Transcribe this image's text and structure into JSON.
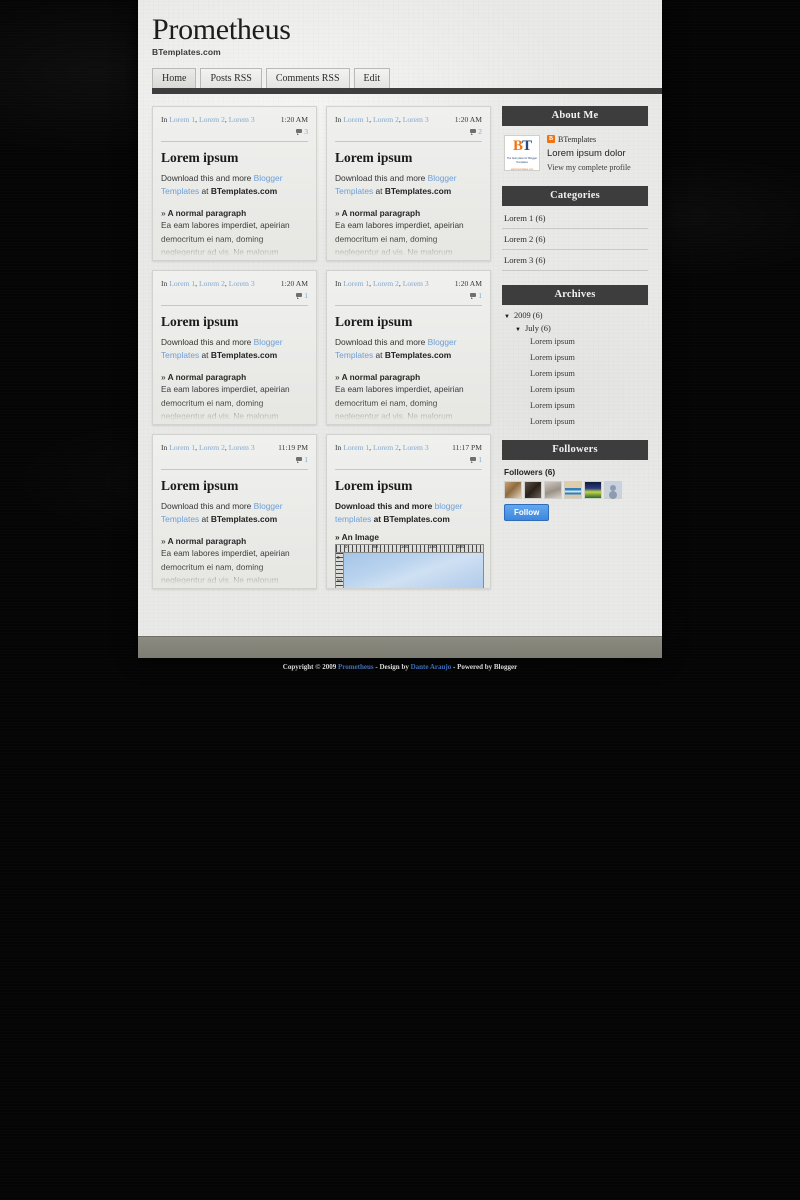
{
  "header": {
    "title": "Prometheus",
    "description": "BTemplates.com",
    "nav": [
      {
        "label": "Home",
        "active": true
      },
      {
        "label": "Posts RSS",
        "active": false
      },
      {
        "label": "Comments RSS",
        "active": false
      },
      {
        "label": "Edit",
        "active": false
      }
    ]
  },
  "posts": [
    {
      "in_label": "In",
      "tags": [
        "Lorem 1",
        "Lorem 2",
        "Lorem 3"
      ],
      "time": "1:20 AM",
      "comments": "3",
      "title": "Lorem ipsum",
      "lead_prefix": "Download this and more ",
      "lead_link": "Blogger Templates",
      "lead_mid": " at ",
      "lead_bold": "BTemplates.com",
      "sub_head": "A normal paragraph",
      "excerpt": "Ea eam labores imperdiet, apeirian democritum ei nam, doming neglegentur ad vis. Ne malorum ceteros feugait quo, ius ea liber efficiendi cum, ne cum dolorem"
    },
    {
      "in_label": "In",
      "tags": [
        "Lorem 1",
        "Lorem 2",
        "Lorem 3"
      ],
      "time": "1:20 AM",
      "comments": "2",
      "title": "Lorem ipsum",
      "lead_prefix": "Download this and more ",
      "lead_link": "Blogger Templates",
      "lead_mid": " at ",
      "lead_bold": "BTemplates.com",
      "sub_head": "A normal paragraph",
      "excerpt": "Ea eam labores imperdiet, apeirian democritum ei nam, doming neglegentur ad vis. Ne malorum ceteros feugait quo, ius ea liber efficiendi cum, ne cum dolorem"
    },
    {
      "in_label": "In",
      "tags": [
        "Lorem 1",
        "Lorem 2",
        "Lorem 3"
      ],
      "time": "1:20 AM",
      "comments": "1",
      "title": "Lorem ipsum",
      "lead_prefix": "Download this and more ",
      "lead_link": "Blogger Templates",
      "lead_mid": " at ",
      "lead_bold": "BTemplates.com",
      "sub_head": "A normal paragraph",
      "excerpt": "Ea eam labores imperdiet, apeirian democritum ei nam, doming neglegentur ad vis. Ne malorum ceteros feugait quo, ius ea liber efficiendi cum, ne cum dolorem"
    },
    {
      "in_label": "In",
      "tags": [
        "Lorem 1",
        "Lorem 2",
        "Lorem 3"
      ],
      "time": "1:20 AM",
      "comments": "1",
      "title": "Lorem ipsum",
      "lead_prefix": "Download this and more ",
      "lead_link": "Blogger Templates",
      "lead_mid": " at ",
      "lead_bold": "BTemplates.com",
      "sub_head": "A normal paragraph",
      "excerpt": "Ea eam labores imperdiet, apeirian democritum ei nam, doming neglegentur ad vis. Ne malorum ceteros feugait quo, ius ea liber efficiendi cum, ne cum dolorem"
    },
    {
      "in_label": "In",
      "tags": [
        "Lorem 1",
        "Lorem 2",
        "Lorem 3"
      ],
      "time": "11:19 PM",
      "comments": "1",
      "title": "Lorem ipsum",
      "lead_prefix": "Download this and more ",
      "lead_link": "Blogger Templates",
      "lead_mid": " at ",
      "lead_bold": "BTemplates.com",
      "sub_head": "A normal paragraph",
      "excerpt": "Ea eam labores imperdiet, apeirian democritum ei nam, doming neglegentur ad vis. Ne malorum ceteros feugait quo, ius ea liber efficiendi cum, ne cum dolorem"
    },
    {
      "in_label": "In",
      "tags": [
        "Lorem 1",
        "Lorem 2",
        "Lorem 3"
      ],
      "time": "11:17 PM",
      "comments": "1",
      "title": "Lorem ipsum",
      "lead_prefix": "Download this and more ",
      "lead_link": "blogger templates",
      "lead_mid": " at ",
      "lead_bold": "BTemplates.com",
      "sub_head": "An Image",
      "image": {
        "ruler_top_ticks": [
          "0",
          "50",
          "100",
          "150",
          "200"
        ],
        "ruler_left_ticks": [
          "0",
          "50"
        ],
        "alt": "sky-image"
      }
    }
  ],
  "sidebar": {
    "about": {
      "title": "About Me",
      "blogger_icon_letter": "B",
      "blogger_name": "BTemplates",
      "logo_mark_b": "B",
      "logo_mark_t": "T",
      "logo_sub1": "The best place for Blogger Templates",
      "logo_sub2": "www.btemplates.com",
      "profile_name": "Lorem ipsum dolor",
      "profile_link": "View my complete profile"
    },
    "categories": {
      "title": "Categories",
      "items": [
        "Lorem 1 (6)",
        "Lorem 2 (6)",
        "Lorem 3 (6)"
      ]
    },
    "archives": {
      "title": "Archives",
      "year": "2009 (6)",
      "month": "July (6)",
      "items": [
        "Lorem ipsum",
        "Lorem ipsum",
        "Lorem ipsum",
        "Lorem ipsum",
        "Lorem ipsum",
        "Lorem ipsum"
      ]
    },
    "followers": {
      "title": "Followers",
      "count_label": "Followers (6)",
      "avatars": [
        "avatar-1",
        "avatar-2",
        "avatar-3",
        "avatar-4",
        "avatar-5",
        "avatar-6"
      ],
      "follow_button": "Follow"
    }
  },
  "footer": {
    "copyright_prefix": "Copyright © 2009 ",
    "site_link": "Prometheus",
    "mid": " - Design by ",
    "author_link": "Dante Araujo",
    "suffix": " - Powered by Blogger"
  }
}
